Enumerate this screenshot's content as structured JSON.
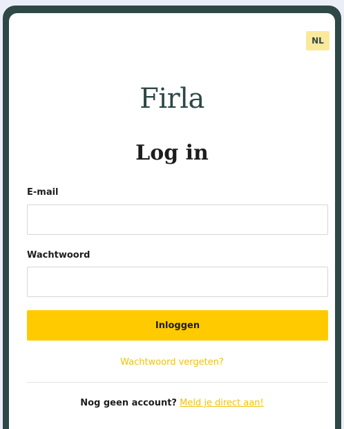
{
  "language": {
    "code": "NL"
  },
  "brand": {
    "logo_text": "Firla"
  },
  "login": {
    "title": "Log in",
    "email_label": "E-mail",
    "email_value": "",
    "password_label": "Wachtwoord",
    "password_value": "",
    "submit_label": "Inloggen",
    "forgot_label": "Wachtwoord vergeten?",
    "no_account_text": "Nog geen account?",
    "signup_link": "Meld je direct aan!"
  },
  "colors": {
    "frame": "#2e4747",
    "accent": "#ffcb00",
    "lang_badge": "#fbe99b",
    "link": "#f2c200"
  }
}
